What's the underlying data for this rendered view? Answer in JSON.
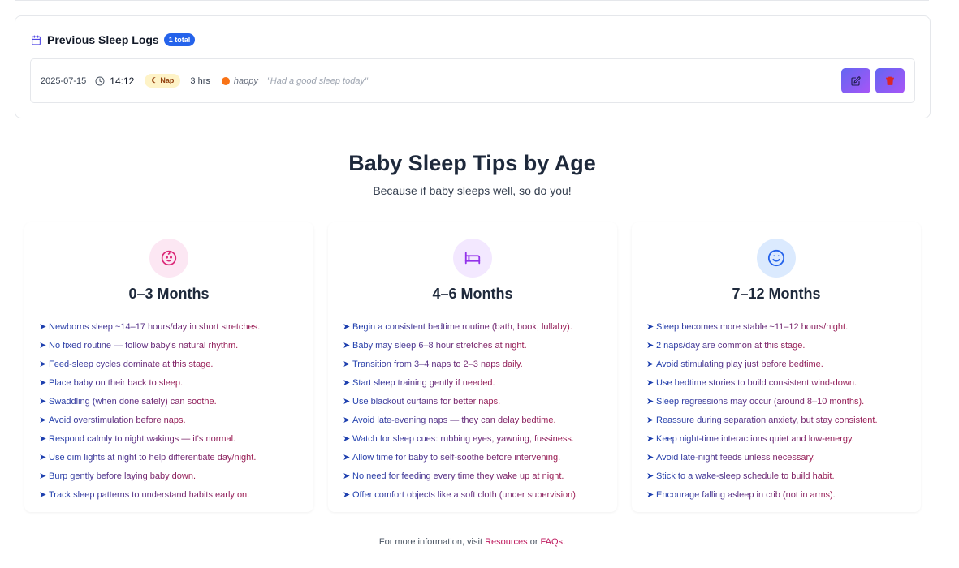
{
  "logs": {
    "title": "Previous Sleep Logs",
    "count_badge": "1 total",
    "entries": [
      {
        "date": "2025-07-15",
        "time": "14:12",
        "type": "Nap",
        "duration": "3 hrs",
        "mood": "happy",
        "note": "\"Had a good sleep today\""
      }
    ]
  },
  "tips": {
    "title": "Baby Sleep Tips by Age",
    "subtitle": "Because if baby sleeps well, so do you!",
    "cards": [
      {
        "title": "0–3 Months",
        "icon": "baby-face-icon",
        "icon_color": "#db2777",
        "tips": [
          "Newborns sleep ~14–17 hours/day in short stretches.",
          "No fixed routine — follow baby's natural rhythm.",
          "Feed-sleep cycles dominate at this stage.",
          "Place baby on their back to sleep.",
          "Swaddling (when done safely) can soothe.",
          "Avoid overstimulation before naps.",
          "Respond calmly to night wakings — it's normal.",
          "Use dim lights at night to help differentiate day/night.",
          "Burp gently before laying baby down.",
          "Track sleep patterns to understand habits early on."
        ]
      },
      {
        "title": "4–6 Months",
        "icon": "bed-icon",
        "icon_color": "#9333ea",
        "tips": [
          "Begin a consistent bedtime routine (bath, book, lullaby).",
          "Baby may sleep 6–8 hour stretches at night.",
          "Transition from 3–4 naps to 2–3 naps daily.",
          "Start sleep training gently if needed.",
          "Use blackout curtains for better naps.",
          "Avoid late-evening naps — they can delay bedtime.",
          "Watch for sleep cues: rubbing eyes, yawning, fussiness.",
          "Allow time for baby to self-soothe before intervening.",
          "No need for feeding every time they wake up at night.",
          "Offer comfort objects like a soft cloth (under supervision)."
        ]
      },
      {
        "title": "7–12 Months",
        "icon": "smile-icon",
        "icon_color": "#2563eb",
        "tips": [
          "Sleep becomes more stable ~11–12 hours/night.",
          "2 naps/day are common at this stage.",
          "Avoid stimulating play just before bedtime.",
          "Use bedtime stories to build consistent wind-down.",
          "Sleep regressions may occur (around 8–10 months).",
          "Reassure during separation anxiety, but stay consistent.",
          "Keep night-time interactions quiet and low-energy.",
          "Avoid late-night feeds unless necessary.",
          "Stick to a wake-sleep schedule to build habit.",
          "Encourage falling asleep in crib (not in arms)."
        ]
      }
    ]
  },
  "footer": {
    "prefix": "For more information, visit ",
    "resources_link": "Resources",
    "middle": " or ",
    "faqs_link": "FAQs",
    "suffix": "."
  },
  "colors": {
    "accent_blue": "#2563eb",
    "button_gradient_start": "#6366f1",
    "button_gradient_end": "#a855f7",
    "link_pink": "#be185d"
  }
}
